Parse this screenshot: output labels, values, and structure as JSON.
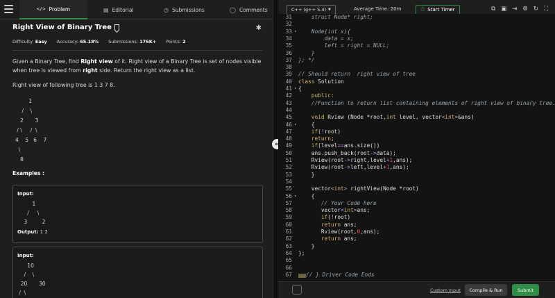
{
  "left_tabs": {
    "problem": "Problem",
    "editorial": "Editorial",
    "submissions": "Submissions",
    "comments": "Comments"
  },
  "problem": {
    "title": "Right View of Binary Tree",
    "difficulty_label": "Difficulty:",
    "difficulty": "Easy",
    "accuracy_label": "Accuracy:",
    "accuracy": "65.18%",
    "submissions_label": "Submissions:",
    "submissions": "176K+",
    "points_label": "Points:",
    "points": "2",
    "desc_1": "Given a Binary Tree, find ",
    "desc_bold_1": "Right view",
    "desc_2": " of it. Right view of a Binary Tree is set of nodes visible when tree is viewed from ",
    "desc_bold_2": "right",
    "desc_3": " side. Return the right view as a list.",
    "sub": "Right view of following tree is 1 3 7 8.",
    "tree": "        1\n    /    \\\n   2       3\n / \\     /  \\\n4    5   6    7\n  \\\n   8",
    "examples_label": "Examples :",
    "example1": {
      "input_label": "Input:",
      "tree": "         1\n      /     \\\n    3         2",
      "output_label": "Output:",
      "output": "1  2"
    },
    "example2": {
      "input_label": "Input:",
      "tree": "      10\n    /    \\\n  20       30\n /  \\"
    }
  },
  "editor": {
    "language": "C++ (g++ 5.4)",
    "avg_time": "Average Time: 20m",
    "timer_label": "Start Timer",
    "lines": [
      {
        "n": "31",
        "fold": "",
        "html": "    struct Node* right;",
        "cls": "cm"
      },
      {
        "n": "32",
        "fold": "",
        "html": "",
        "cls": "cm"
      },
      {
        "n": "33",
        "fold": "▾",
        "html": "    Node(int x){",
        "cls": "cm"
      },
      {
        "n": "34",
        "fold": "",
        "html": "        data = x;",
        "cls": "cm"
      },
      {
        "n": "35",
        "fold": "",
        "html": "        left = right = NULL;",
        "cls": "cm"
      },
      {
        "n": "36",
        "fold": "",
        "html": "    }",
        "cls": "cm"
      },
      {
        "n": "37",
        "fold": "",
        "html": "}; */",
        "cls": "cm"
      },
      {
        "n": "38",
        "fold": "",
        "html": "",
        "cls": ""
      },
      {
        "n": "39",
        "fold": "",
        "html": "// Should return  right view of tree",
        "cls": "cm"
      },
      {
        "n": "40",
        "fold": "",
        "html": "class Solution",
        "cls": ""
      },
      {
        "n": "41",
        "fold": "▾",
        "html": "{",
        "cls": ""
      },
      {
        "n": "42",
        "fold": "",
        "html": "    public:",
        "cls": "kw"
      },
      {
        "n": "43",
        "fold": "",
        "html": "    //Function to return list containing elements of right view of binary tree.",
        "cls": "cm"
      },
      {
        "n": "44",
        "fold": "",
        "html": "",
        "cls": ""
      },
      {
        "n": "45",
        "fold": "",
        "html": "    void Rview (Node *root,int level, vector<int>&ans)",
        "cls": ""
      },
      {
        "n": "46",
        "fold": "▾",
        "html": "    {",
        "cls": ""
      },
      {
        "n": "47",
        "fold": "",
        "html": "    if(!root)",
        "cls": ""
      },
      {
        "n": "48",
        "fold": "",
        "html": "    return;",
        "cls": ""
      },
      {
        "n": "49",
        "fold": "",
        "html": "    if(level==ans.size())",
        "cls": ""
      },
      {
        "n": "50",
        "fold": "",
        "html": "    ans.push_back(root->data);",
        "cls": ""
      },
      {
        "n": "51",
        "fold": "",
        "html": "    Rview(root->right,level+1,ans);",
        "cls": ""
      },
      {
        "n": "52",
        "fold": "",
        "html": "    Rview(root->left,level+1,ans);",
        "cls": ""
      },
      {
        "n": "53",
        "fold": "",
        "html": "    }",
        "cls": ""
      },
      {
        "n": "54",
        "fold": "",
        "html": "",
        "cls": ""
      },
      {
        "n": "55",
        "fold": "",
        "html": "    vector<int> rightView(Node *root)",
        "cls": ""
      },
      {
        "n": "56",
        "fold": "▾",
        "html": "    {",
        "cls": ""
      },
      {
        "n": "57",
        "fold": "",
        "html": "       // Your Code here",
        "cls": "cm"
      },
      {
        "n": "58",
        "fold": "",
        "html": "       vector<int>ans;",
        "cls": ""
      },
      {
        "n": "59",
        "fold": "",
        "html": "       if(!root)",
        "cls": ""
      },
      {
        "n": "60",
        "fold": "",
        "html": "       return ans;",
        "cls": ""
      },
      {
        "n": "61",
        "fold": "",
        "html": "       Rview(root,0,ans);",
        "cls": ""
      },
      {
        "n": "62",
        "fold": "",
        "html": "       return ans;",
        "cls": ""
      },
      {
        "n": "63",
        "fold": "",
        "html": "    }",
        "cls": ""
      },
      {
        "n": "64",
        "fold": "",
        "html": "};",
        "cls": ""
      },
      {
        "n": "65",
        "fold": "",
        "html": "",
        "cls": ""
      },
      {
        "n": "66",
        "fold": "",
        "html": "",
        "cls": ""
      },
      {
        "n": "67",
        "fold": "",
        "html": "// } Driver Code Ends",
        "cls": "cm",
        "hi": "..."
      }
    ]
  },
  "footer": {
    "custom_input": "Custom Input",
    "compile_run": "Compile & Run",
    "submit": "Submit"
  },
  "colors": {
    "accent": "#2f8d46",
    "keyword": "#d4b86a",
    "number": "#e05252",
    "comment": "#9aa7b0"
  }
}
